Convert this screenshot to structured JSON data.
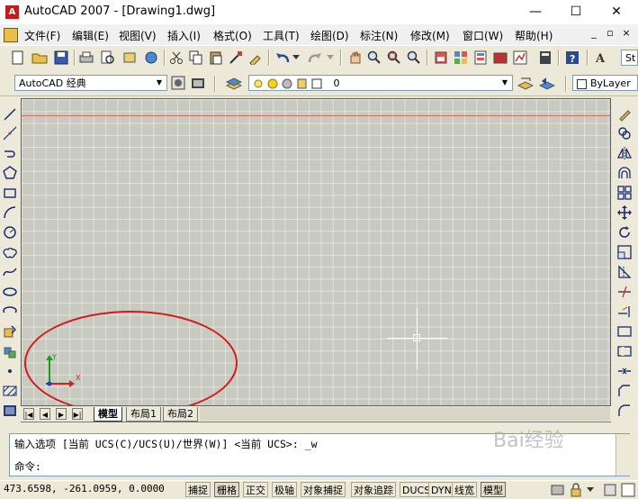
{
  "window": {
    "title": "AutoCAD 2007 - [Drawing1.dwg]",
    "app_icon_text": "A",
    "minimize": "—",
    "maximize": "☐",
    "close": "✕"
  },
  "menu": {
    "items": [
      "文件(F)",
      "编辑(E)",
      "视图(V)",
      "插入(I)",
      "格式(O)",
      "工具(T)",
      "绘图(D)",
      "标注(N)",
      "修改(M)",
      "窗口(W)",
      "帮助(H)"
    ],
    "mdi_min": "_",
    "mdi_restore": "▫",
    "mdi_close": "×"
  },
  "toolbar2": {
    "workspace": "AutoCAD 经典",
    "layer": "0",
    "color": "ByLayer",
    "style_cut": "St"
  },
  "layout_tabs": [
    "模型",
    "布局1",
    "布局2"
  ],
  "command": {
    "line1": "输入选项 [当前 UCS(C)/UCS(U)/世界(W)] <当前 UCS>: _w",
    "line2": "命令:"
  },
  "status": {
    "coords": "473.6598,  -261.0959, 0.0000",
    "buttons": [
      "捕捉",
      "栅格",
      "正交",
      "极轴",
      "对象捕捉",
      "对象追踪",
      "DUCS",
      "DYN",
      "线宽",
      "模型"
    ],
    "active": [
      "栅格",
      "模型"
    ]
  },
  "ucs": {
    "x": "X",
    "y": "Y"
  },
  "watermark": "Bai经验",
  "colors": {
    "drawing_bg": "#c8cac0",
    "annotation_ellipse": "#d11c1c",
    "ucs_x": "#d42020",
    "ucs_y": "#1aa01a",
    "ucs_z": "#2040c0"
  }
}
